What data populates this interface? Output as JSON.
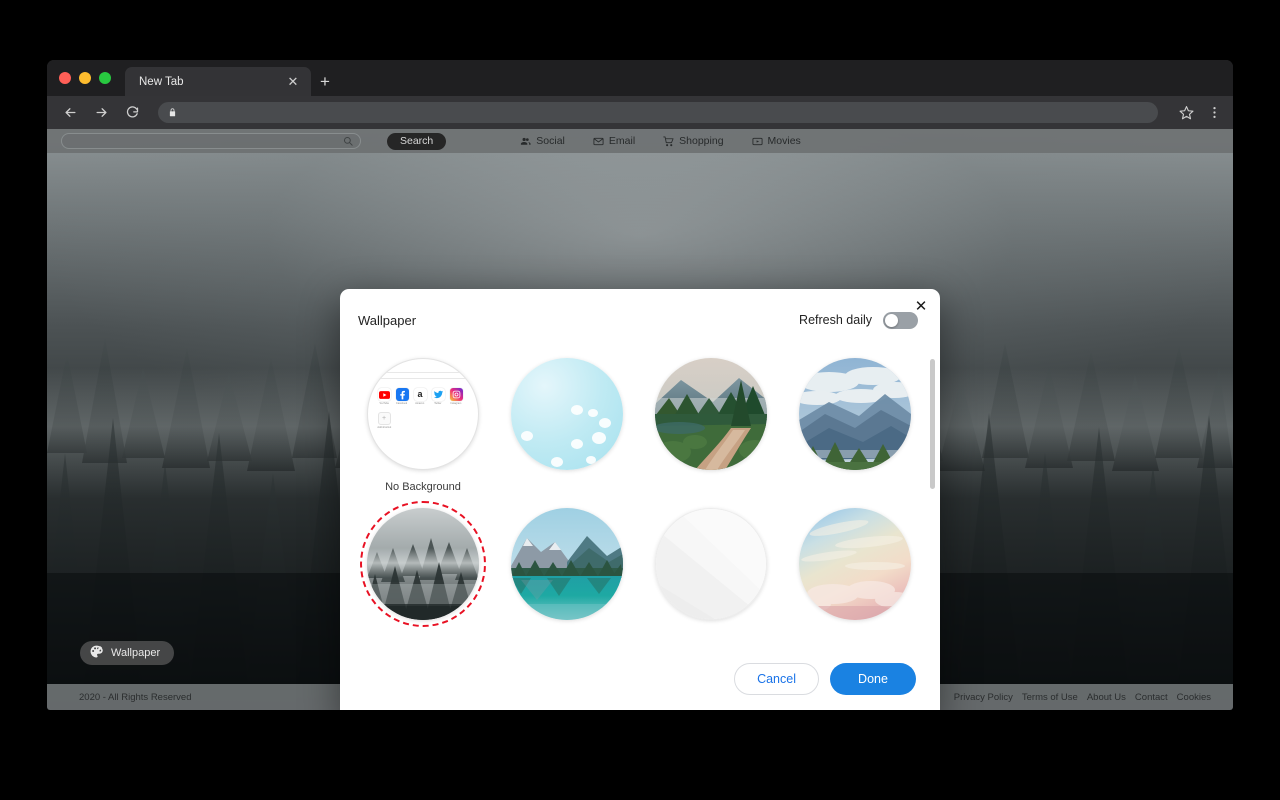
{
  "browser": {
    "tab": {
      "title": "New Tab",
      "close_icon": "close-icon"
    },
    "new_tab_icon": "plus-icon",
    "nav": {
      "back_icon": "arrow-left-icon",
      "forward_icon": "arrow-right-icon",
      "reload_icon": "reload-icon",
      "lock_icon": "lock-icon",
      "url_value": "",
      "bookmark_icon": "star-icon",
      "menu_icon": "three-dot-menu-icon"
    }
  },
  "site": {
    "search": {
      "placeholder": "",
      "value": "",
      "icon": "search-icon"
    },
    "search_button": "Search",
    "links": [
      {
        "label": "Social",
        "icon": "people-icon"
      },
      {
        "label": "Email",
        "icon": "envelope-icon"
      },
      {
        "label": "Shopping",
        "icon": "cart-icon"
      },
      {
        "label": "Movies",
        "icon": "video-icon"
      }
    ],
    "wallpaper_button": {
      "label": "Wallpaper",
      "icon": "palette-icon"
    },
    "footer": {
      "copyright": "2020 - All Rights Reserved",
      "links": [
        "Privacy Policy",
        "Terms of Use",
        "About Us",
        "Contact",
        "Cookies"
      ]
    }
  },
  "modal": {
    "title": "Wallpaper",
    "refresh_daily_label": "Refresh daily",
    "refresh_daily_on": false,
    "close_icon": "close-icon",
    "items": [
      {
        "label": "No Background",
        "kind": "no-background",
        "selected": false
      },
      {
        "label": "",
        "kind": "sky-clouds",
        "selected": false
      },
      {
        "label": "",
        "kind": "forest-path",
        "selected": false
      },
      {
        "label": "",
        "kind": "blue-mountains",
        "selected": false
      },
      {
        "label": "",
        "kind": "misty-forest",
        "selected": true
      },
      {
        "label": "",
        "kind": "alpine-lake",
        "selected": false
      },
      {
        "label": "",
        "kind": "white-paper",
        "selected": false
      },
      {
        "label": "",
        "kind": "pastel-sunset",
        "selected": false
      }
    ],
    "shortcuts": [
      {
        "name": "YouTube",
        "color": "#ff0000"
      },
      {
        "name": "Facebook",
        "color": "#1877f2"
      },
      {
        "name": "Amazon",
        "color": "#ffffff"
      },
      {
        "name": "Twitter",
        "color": "#ffffff"
      },
      {
        "name": "Instagram",
        "color": "#c13584"
      }
    ],
    "add_shortcut": {
      "label": "Add shortcut",
      "icon": "plus-icon"
    },
    "cancel_button": "Cancel",
    "done_button": "Done"
  },
  "colors": {
    "accent_blue": "#1a82e2",
    "link_blue": "#1a73e8",
    "selection_red": "#e81123"
  }
}
